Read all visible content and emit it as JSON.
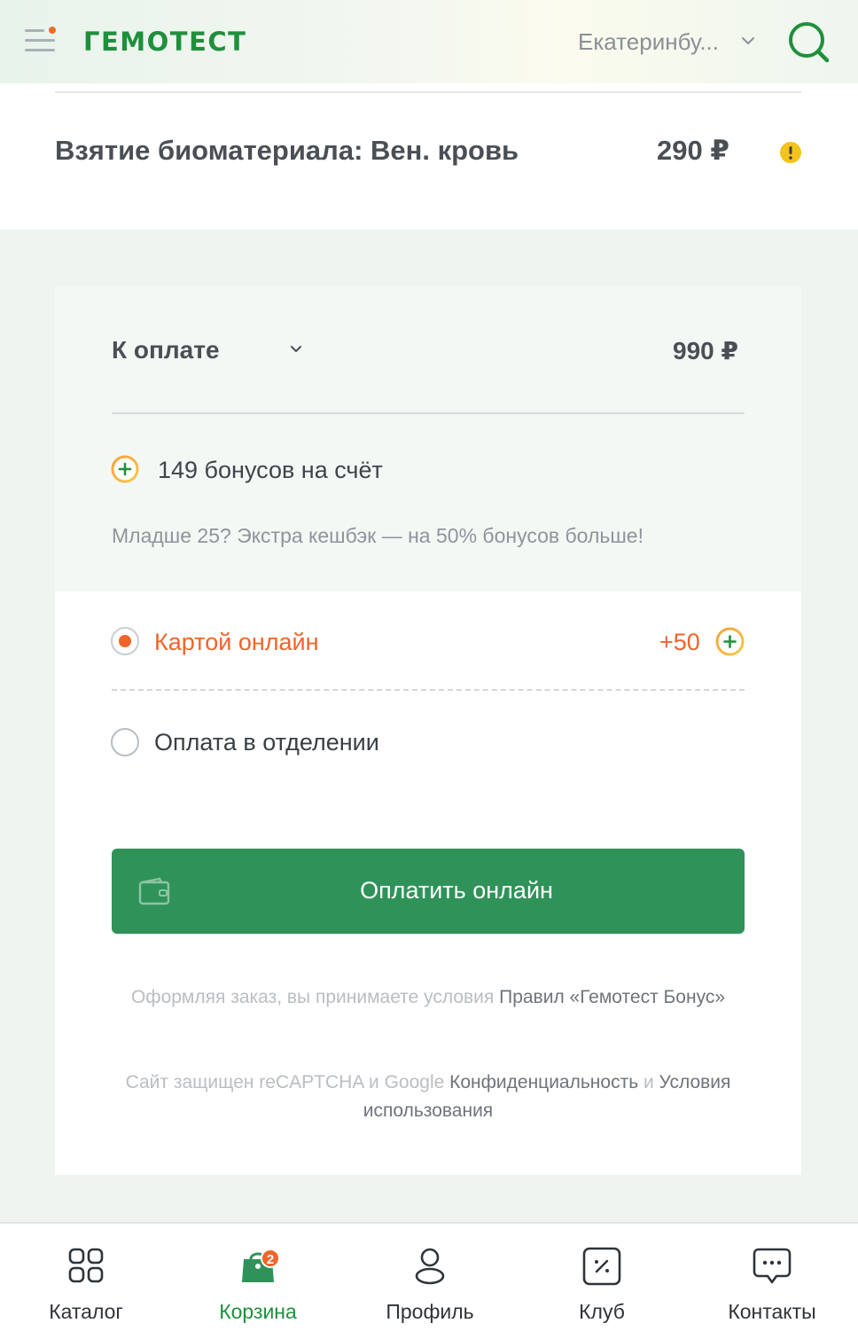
{
  "header": {
    "logo": "ГЕМОТЕСТ",
    "city": "Екатеринбу..."
  },
  "service": {
    "name": "Взятие биоматериала: Вен. кровь",
    "price": "290 ₽"
  },
  "summary": {
    "total_label": "К оплате",
    "total_amount": "990 ₽",
    "bonus_text": "149 бонусов на счёт",
    "promo_text": "Младше 25? Экстра кешбэк — на 50% бонусов больше!"
  },
  "payment": {
    "option_card": "Картой онлайн",
    "option_card_bonus": "+50",
    "option_office": "Оплата в отделении",
    "pay_button": "Оплатить онлайн",
    "terms_prefix": "Оформляя заказ, вы принимаете условия ",
    "terms_link": "Правил «Гемотест Бонус»",
    "captcha_prefix": "Сайт защищен reCAPTCHA и Google ",
    "captcha_link_privacy": "Конфиденциальность",
    "captcha_and": " и ",
    "captcha_link_terms": "Условия использования"
  },
  "tabbar": {
    "catalog": "Каталог",
    "cart": "Корзина",
    "cart_badge": "2",
    "profile": "Профиль",
    "club": "Клуб",
    "contacts": "Контакты"
  },
  "colors": {
    "brand_green": "#1f8f3c",
    "button_green": "#2f9359",
    "accent_orange": "#f0642a"
  }
}
